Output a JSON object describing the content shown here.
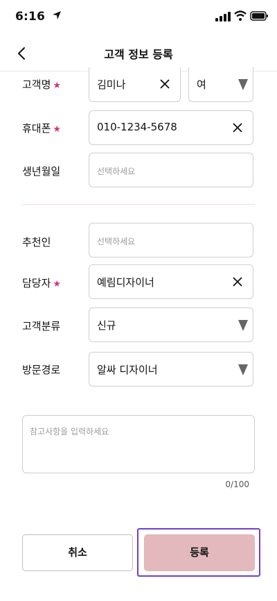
{
  "status_bar": {
    "time": "6:16"
  },
  "header": {
    "title": "고객 정보 등록"
  },
  "form": {
    "customer_name": {
      "label": "고객명",
      "value": "김미나",
      "gender": "여"
    },
    "mobile": {
      "label": "휴대폰",
      "value": "010-1234-5678"
    },
    "birthday": {
      "label": "생년월일",
      "placeholder": "선택하세요"
    },
    "referrer": {
      "label": "추천인",
      "placeholder": "선택하세요"
    },
    "manager": {
      "label": "담당자",
      "value": "예림디자이너"
    },
    "category": {
      "label": "고객분류",
      "value": "신규"
    },
    "visit_route": {
      "label": "방문경로",
      "value": "알싸 디자이너"
    },
    "memo": {
      "placeholder": "참고사항을 입력하세요",
      "count": "0/100"
    },
    "required_mark": "★"
  },
  "buttons": {
    "cancel": "취소",
    "register": "등록"
  },
  "colors": {
    "accent_star": "#d6337a",
    "register_bg": "#e4b9bd",
    "focus_outline": "#6f3fd0"
  }
}
